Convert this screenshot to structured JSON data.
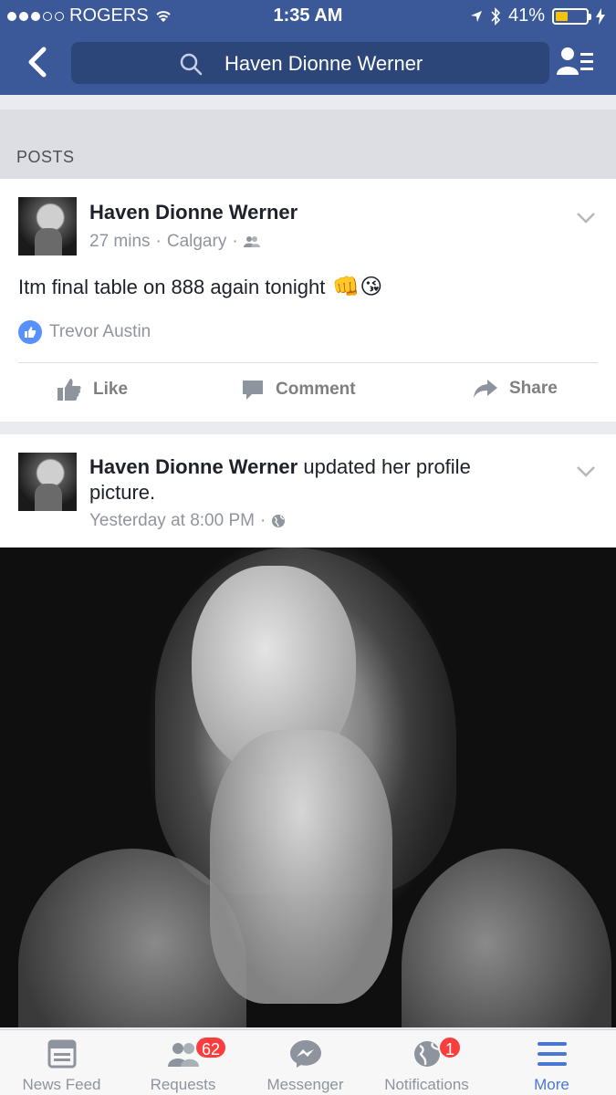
{
  "status_bar": {
    "carrier": "ROGERS",
    "time": "1:35 AM",
    "battery": "41%",
    "battery_level": 0.41
  },
  "header": {
    "search_text": "Haven Dionne Werner"
  },
  "section": {
    "title": "POSTS"
  },
  "posts": [
    {
      "author": "Haven Dionne Werner",
      "time": "27 mins",
      "location": "Calgary",
      "text": "Itm final table on 888 again tonight",
      "emojis": "👊😘",
      "liked_by": "Trevor Austin",
      "actions": {
        "like": "Like",
        "comment": "Comment",
        "share": "Share"
      }
    },
    {
      "author": "Haven Dionne Werner",
      "action_text": "updated her profile picture.",
      "time": "Yesterday at 8:00 PM"
    }
  ],
  "tabbar": {
    "items": [
      {
        "label": "News Feed"
      },
      {
        "label": "Requests",
        "badge": "62"
      },
      {
        "label": "Messenger"
      },
      {
        "label": "Notifications",
        "badge": "1"
      },
      {
        "label": "More"
      }
    ]
  },
  "colors": {
    "brand": "#3b5998",
    "active_tab": "#4a76d4",
    "badge": "#fa3e3e"
  }
}
